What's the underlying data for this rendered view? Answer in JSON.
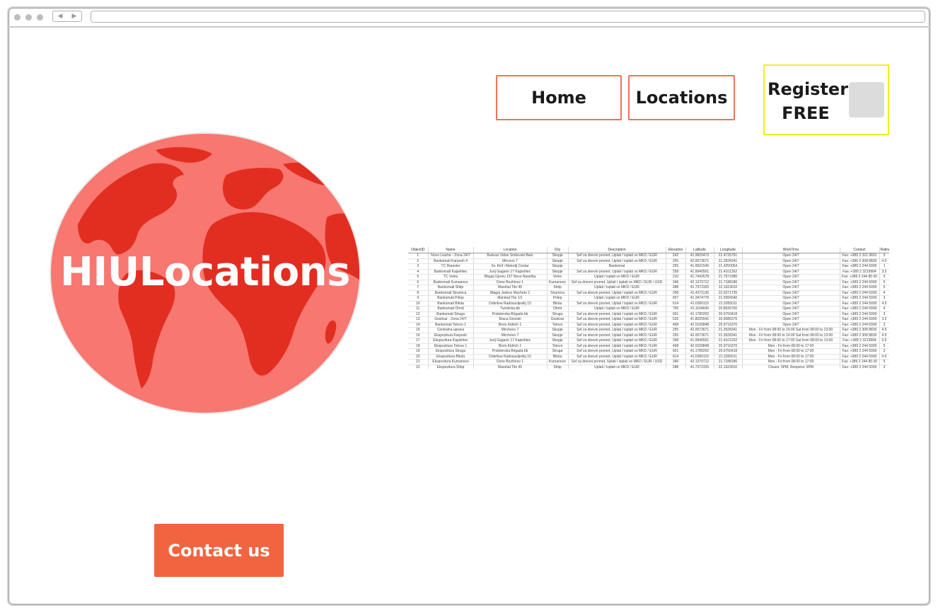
{
  "nav": {
    "home_label": "Home",
    "locations_label": "Locations",
    "register_label_line1": "Register",
    "register_label_line2": "FREE"
  },
  "brand": {
    "name": "HIULocations"
  },
  "contact": {
    "label": "Contact us"
  },
  "colors": {
    "accent": "#f26440",
    "nav_border": "#f0735a",
    "register_border": "#f2ef1d",
    "globe_ocean": "#f87770",
    "globe_land": "#e22e20"
  },
  "locations_table": {
    "headers": [
      "ObjectID",
      "Name",
      "Location",
      "City",
      "Description",
      "Elevation",
      "Latitude",
      "Longitude",
      "WorkTime",
      "Contact",
      "Rating"
    ],
    "rows": [
      [
        "1",
        "Novo Lisiche - Zona 24/7",
        "Bulevar Vidoe Smilevski Bato",
        "Skopje",
        "Sef za dnevni promet, Uplati / isplati vo MKD / EUR",
        "242",
        "41.9820473",
        "21.4725791",
        "Open 24/7",
        "Fax: +389 2 321 9601",
        "3"
      ],
      [
        "2",
        "Bankomati Karposh 4",
        "Mircevo 7",
        "Skopje",
        "Sef za dnevni promet, Uplati / isplati vo MKD / EUR",
        "255",
        "42.0073671",
        "21.3928341",
        "Open 24/7",
        "Fax: +389 2 308 8830",
        "4.5"
      ],
      [
        "3",
        "TC Ramstor",
        "Sv. Kiril i Metodij Centar",
        "Skopje",
        "Bankomat",
        "255",
        "41.9921545",
        "21.4250054",
        "Open 24/7",
        "Fax: +389 2 244 5000",
        "1"
      ],
      [
        "4",
        "Bankomati Kapishtec",
        "Jurij Gagarin 17 Kapishtec",
        "Skopje",
        "Sef za dnevni promet, Uplati / isplati vo MKD / EUR",
        "258",
        "41.9940501",
        "21.4101262",
        "Open 24/7",
        "Fax: +389 2 3219904",
        "3.5"
      ],
      [
        "5",
        "TC Veles",
        "Blagoj Gjorev 157 Novo Naselba",
        "Veles",
        "Uplati / isplati vo MKD / EUR",
        "210",
        "41.7442678",
        "21.7971980",
        "Open 24/7",
        "Fax: +389 2 244 80 00",
        "3"
      ],
      [
        "6",
        "Bankomati Kumanovo",
        "Done Bozhinov 1",
        "Kumanovo",
        "Sef za dnevni promet, Uplati / isplati vo MKD / EUR / USD",
        "346",
        "42.1370712",
        "21.7188186",
        "Open 24/7",
        "Fax: +389 2 244 5000",
        "5"
      ],
      [
        "7",
        "Bankomati Shtip",
        "Marshal Tito 45",
        "Shtip",
        "Uplati / isplati vo MKD / EUR",
        "288",
        "41.7372325",
        "22.1923010",
        "Open 24/7",
        "Fax: +389 2 244 5000",
        "5"
      ],
      [
        "8",
        "Bankomati Strumica",
        "Blagoj Jankov Muchеto 2",
        "Strumica",
        "Sef za dnevni promet, Uplati / isplati vo MKD / EUR",
        "258",
        "41.4371136",
        "22.6371735",
        "Open 24/7",
        "Fax: +389 2 244 5000",
        "4"
      ],
      [
        "9",
        "Bankomati Prilep",
        "Marshal Tito 1/1",
        "Prilep",
        "Uplati / isplati vo MKD / EUR",
        "657",
        "41.3474776",
        "21.5556540",
        "Open 24/7",
        "Fax: +389 2 244 5000",
        "3"
      ],
      [
        "10",
        "Bankomati Bitola",
        "Dobrilow Radosavljevikj 15",
        "Bitola",
        "Sef za dnevni promet, Uplati / isplati vo MKD / EUR",
        "614",
        "41.0300115",
        "21.3355011",
        "Open 24/7",
        "Fax: +389 2 244 5000",
        "4.5"
      ],
      [
        "11",
        "Bankomati Ohrid",
        "Turisticka bb",
        "Ohrid",
        "Uplati / isplati vo MKD / EUR",
        "705",
        "41.1164606",
        "20.8026760",
        "Open 24/7",
        "Fax: +389 2 244 5000",
        "4"
      ],
      [
        "12",
        "Bankomati Struga",
        "Proleterska Brigada bb",
        "Struga",
        "Sef za dnevni promet, Uplati / isplati vo MKD / EUR",
        "601",
        "41.1780202",
        "20.6750418",
        "Open 24/7",
        "Fax: +389 2 244 5000",
        "3"
      ],
      [
        "13",
        "Gostivar - Zona 24/7",
        "Braca Ginoski",
        "Gostivar",
        "Sef za dnevni promet, Uplati / isplati vo MKD / EUR",
        "526",
        "41.8025541",
        "20.9086376",
        "Open 24/7",
        "Fax: +389 2 244 5000",
        "3.5"
      ],
      [
        "14",
        "Bankomati Tetovo 1",
        "Boris Kidrich 1",
        "Tetovo",
        "Sef za dnevni promet, Uplati / isplati vo MKD / EUR",
        "468",
        "42.0100848",
        "20.9716370",
        "Open 24/7",
        "Fax: +389 2 244 5000",
        "3"
      ],
      [
        "15",
        "Centralna uprava",
        "Mirchevo 7",
        "Skopje",
        "Sef za dnevni promet, Uplati / isplati vo MKD / EUR",
        "255",
        "42.0073671",
        "21.3928341",
        "Mon - Fri from 08:00 to 16:00 Sat from 08:00 to 13:00",
        "Fax: +389 2 308 8830",
        "4.5"
      ],
      [
        "16",
        "Ekspozitura Karposh",
        "Mirchevo 7",
        "Skopje",
        "Sef za dnevni promet, Uplati / isplati vo MKD / EUR",
        "255",
        "42.0073671",
        "21.3928341",
        "Mon - Fri from 08:00 to 16:00 Sat from 08:00 to 13:00",
        "Fax: +389 2 308 8830",
        "4.5"
      ],
      [
        "17",
        "Ekspozitura Kapishtec",
        "Jurij Gagarin 17 Kapishtec",
        "Skopje",
        "Sef za dnevni promet, Uplati / isplati vo MKD / EUR",
        "258",
        "41.9940501",
        "21.4101262",
        "Mon - Fri from 08:00 to 17:00 Sat from 08:00 to 13:00",
        "Fax: +389 2 3219904",
        "3.5"
      ],
      [
        "18",
        "Ekspozitura Tetovo 1",
        "Boris Kidrich 1",
        "Tetovo",
        "Sef za dnevni promet, Uplati / isplati vo MKD / EUR",
        "468",
        "42.0100848",
        "20.9716370",
        "Mon - Fri from 08:00 to 17:00",
        "Fax: +389 2 244 5000",
        "5"
      ],
      [
        "19",
        "Ekspozitura Struga",
        "Proleterska Brigada bb",
        "Struga",
        "Sef za dnevni promet, Uplati / isplati vo MKD / EUR",
        "601",
        "41.1780202",
        "20.6750418",
        "Mon - Fri from 08:00 to 17:00",
        "Fax: +389 2 244 5000",
        "3"
      ],
      [
        "20",
        "Ekspozitura Bitola",
        "Dobrilow Radosavljevikj 15",
        "Bitola",
        "Sef za dnevni promet, Uplati / isplati vo MKD / EUR",
        "614",
        "41.0300115",
        "21.3355011",
        "Mon - Fri from 08:00 to 17:00",
        "Fax: +389 2 244 5000",
        "4.5"
      ],
      [
        "21",
        "Ekspozitura Kumanovo",
        "Done Bozhinov 1",
        "Kumanovo",
        "Sef za dnevni promet, Uplati / isplati vo MKD / EUR / USD",
        "346",
        "42.1370712",
        "21.7188186",
        "Mon - Fri from 08:00 to 17:00",
        "Fax: +389 2 244 80 00",
        "5"
      ],
      [
        "22",
        "Ekspozitura Shtip",
        "Marshal Tito 45",
        "Shtip",
        "Uplati / isplati vo MKD / EUR",
        "288",
        "41.7372325",
        "22.1923010",
        "Closes: 5PM, Reopens: 9PM",
        "Fax: +389 2 244 5000",
        "3"
      ],
      [
        "23",
        "Ekspozitura Strumica",
        "Blagoj Jankov Muchеto 2",
        "Strumica",
        "Sef za dnevni promet, Uplati / isplati vo MKD / EUR",
        "258",
        "41.4371136",
        "22.6371735",
        "Mon - Fri from 08:00 to 17:00",
        "Fax: +389 2 244 5000",
        "4"
      ]
    ]
  }
}
